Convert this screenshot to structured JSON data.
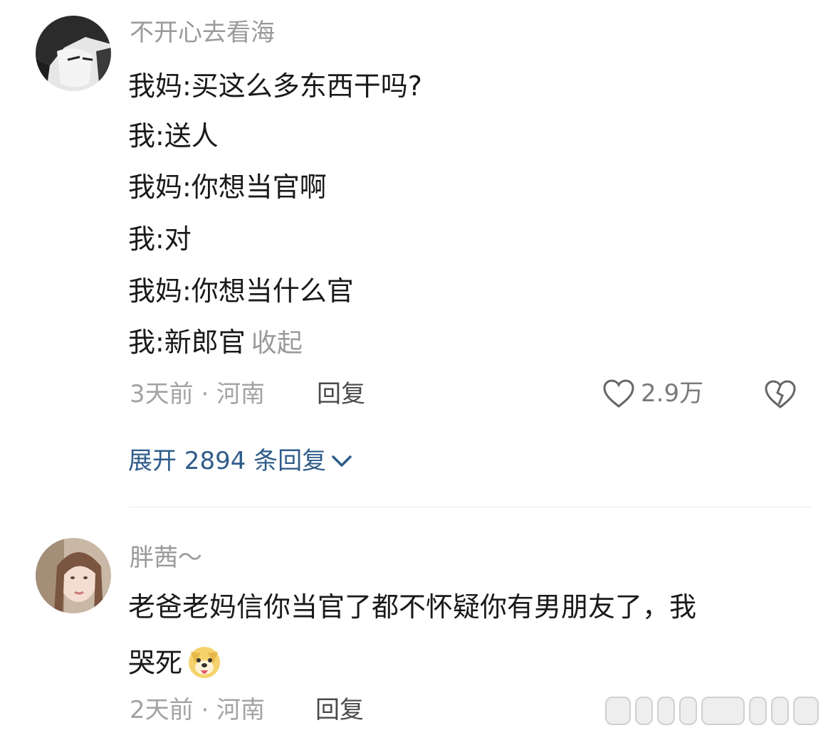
{
  "comments": [
    {
      "username": "不开心去看海",
      "lines": [
        "我妈:买这么多东西干吗?",
        "我:送人",
        "我妈:你想当官啊",
        "我:对",
        "我妈:你想当什么官",
        "我:新郎官"
      ],
      "collapse_label": "收起",
      "meta": "3天前 · 河南",
      "reply_label": "回复",
      "likes": "2.9万",
      "expand_label": "展开 2894 条回复"
    },
    {
      "username": "胖茜～",
      "lines": [
        "老爸老妈信你当官了都不怀疑你有男朋友了，我",
        "哭死"
      ],
      "meta": "2天前 · 河南",
      "reply_label": "回复"
    }
  ],
  "icons": {
    "like": "heart-outline-icon",
    "dislike": "broken-heart-icon",
    "expand": "chevron-down-icon",
    "emoji": "doge-emoji-icon"
  },
  "colors": {
    "link": "#2f5c8a",
    "meta": "#a3a3a3",
    "text": "#1a1a1a"
  }
}
